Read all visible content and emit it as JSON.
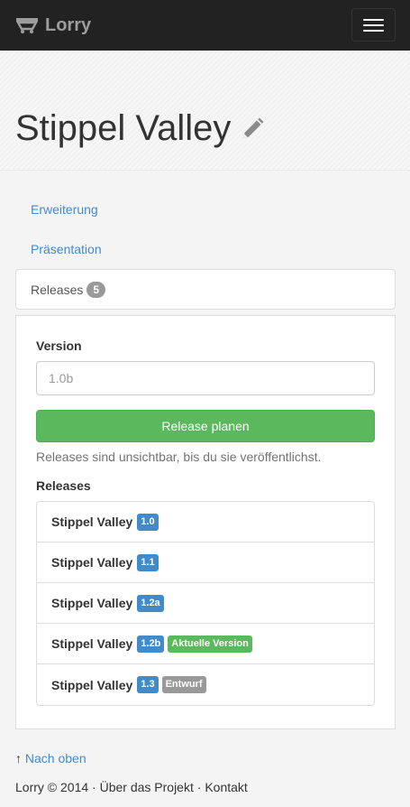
{
  "navbar": {
    "brand": "Lorry",
    "brand_icon": "lorry-logo-icon",
    "menu_icon": "hamburger-menu-icon"
  },
  "page": {
    "title": "Stippel Valley",
    "edit_icon": "pencil-icon"
  },
  "tabs": [
    {
      "label": "Erweiterung"
    },
    {
      "label": "Präsentation"
    },
    {
      "label": "Releases",
      "count": "5",
      "active": true
    }
  ],
  "form": {
    "version_label": "Version",
    "version_placeholder": "1.0b",
    "submit_label": "Release planen",
    "help_text": "Releases sind unsichtbar, bis du sie veröffentlichst."
  },
  "releases": {
    "heading": "Releases",
    "items": [
      {
        "name": "Stippel Valley",
        "version": "1.0"
      },
      {
        "name": "Stippel Valley",
        "version": "1.1"
      },
      {
        "name": "Stippel Valley",
        "version": "1.2a"
      },
      {
        "name": "Stippel Valley",
        "version": "1.2b",
        "status": "Aktuelle Version"
      },
      {
        "name": "Stippel Valley",
        "version": "1.3",
        "status": "Entwurf"
      }
    ]
  },
  "footer": {
    "arrow": "↑",
    "back_to_top": "Nach oben",
    "copyright": "Lorry © 2014",
    "separator": "·",
    "about": "Über das Projekt",
    "contact": "Kontakt"
  },
  "colors": {
    "navbar": "#222222",
    "link": "#428bca",
    "success": "#5cb85c",
    "version_label": "#428bca",
    "draft_label": "#999999"
  }
}
